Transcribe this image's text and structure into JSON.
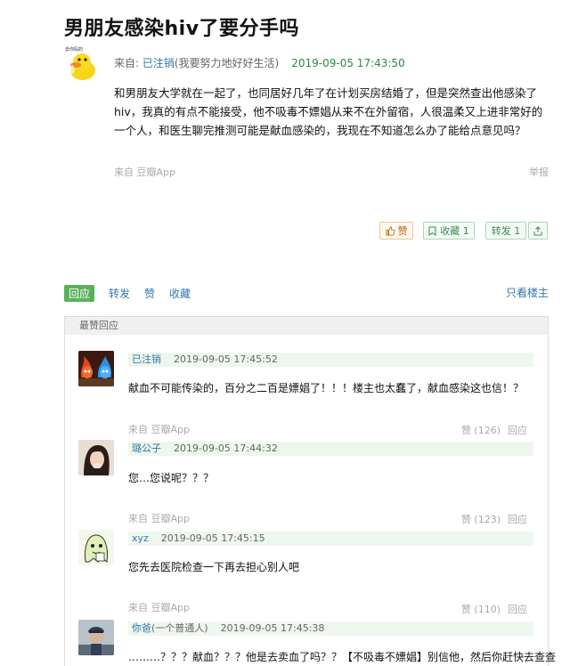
{
  "post": {
    "title": "男朋友感染hiv了要分手吗",
    "from_label": "来自: ",
    "author_name": "已注销",
    "author_note": "(我要努力地好好生活)",
    "timestamp": "2019-09-05 17:43:50",
    "avatar_badge": "去你妈的",
    "body": "和男朋友大学就在一起了，也同居好几年了在计划买房结婚了，但是突然查出他感染了hiv，我真的有点不能接受，他不吸毒不嫖娼从来不在外留宿，人很温柔又上进非常好的一个人，和医生聊完推测可能是献血感染的，我现在不知道怎么办了能给点意见吗？",
    "source": "来自 豆瓣App",
    "report_label": "举报"
  },
  "actions": {
    "like_label": "赞",
    "collect_label": "收藏",
    "collect_count": "1",
    "repost_label": "转发",
    "repost_count": "1"
  },
  "tabs": {
    "items": [
      "回应",
      "转发",
      "赞",
      "收藏"
    ],
    "only_op": "只看楼主"
  },
  "hot": {
    "title": "最赞回应",
    "comments": [
      {
        "user": "已注销",
        "note": "",
        "time": "2019-09-05 17:45:52",
        "text": "献血不可能传染的，百分之二百是嫖娼了！！！楼主也太蠢了，献血感染这也信！？",
        "source": "来自 豆瓣App",
        "likes": "赞 (126)",
        "reply": "回应"
      },
      {
        "user": "璐公子",
        "note": "",
        "time": "2019-09-05 17:44:32",
        "text": "您…您说呢？？？",
        "source": "来自 豆瓣App",
        "likes": "赞 (123)",
        "reply": "回应"
      },
      {
        "user": "xyz",
        "note": "",
        "time": "2019-09-05 17:45:15",
        "text": "您先去医院检查一下再去担心别人吧",
        "source": "来自 豆瓣App",
        "likes": "赞 (110)",
        "reply": "回应"
      },
      {
        "user": "你爸",
        "note": "(一个普通人)",
        "time": "2019-09-05 17:45:38",
        "text": "………？？？献血？？？他是去卖血了吗？？【不吸毒不嫖娼】别信他，然后你赶快去查查",
        "source": "",
        "likes": "",
        "reply": ""
      }
    ]
  },
  "colors": {
    "link": "#3377aa",
    "time_green": "#2b8a3e",
    "tab_active": "#5bb15b",
    "comment_header": "#eef7ee"
  }
}
